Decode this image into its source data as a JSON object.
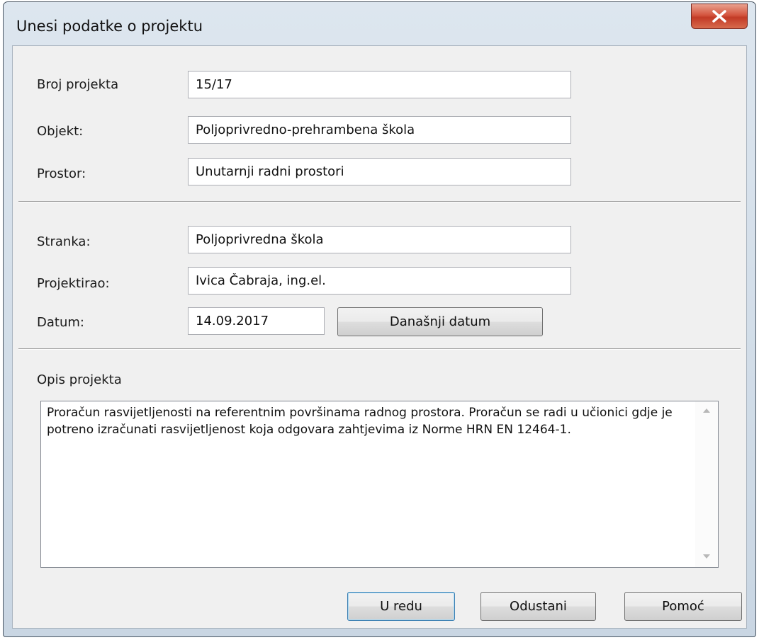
{
  "window": {
    "title": "Unesi podatke o projektu"
  },
  "form": {
    "broj_projekta": {
      "label": "Broj projekta",
      "value": "15/17"
    },
    "objekt": {
      "label": "Objekt:",
      "value": "Poljoprivredno-prehrambena škola"
    },
    "prostor": {
      "label": "Prostor:",
      "value": "Unutarnji radni prostori"
    },
    "stranka": {
      "label": "Stranka:",
      "value": "Poljoprivredna škola"
    },
    "projektirao": {
      "label": "Projektirao:",
      "value": "Ivica Čabraja, ing.el."
    },
    "datum": {
      "label": "Datum:",
      "value": "14.09.2017",
      "today_button": "Današnji datum"
    },
    "opis": {
      "label": "Opis projekta",
      "value": "Proračun rasvijetljenosti na referentnim površinama radnog prostora. Proračun se radi u učionici gdje je potreno izračunati rasvijetljenost koja odgovara zahtjevima iz Norme HRN EN 12464-1."
    }
  },
  "buttons": {
    "ok": "U redu",
    "cancel": "Odustani",
    "help": "Pomoć"
  },
  "colors": {
    "close_button": "#c94a33",
    "client_bg": "#f0f0f0",
    "default_button_border": "#3c7fb1"
  },
  "icons": {
    "close": "close-icon",
    "scroll_up": "scroll-up-arrow-icon",
    "scroll_down": "scroll-down-arrow-icon"
  }
}
